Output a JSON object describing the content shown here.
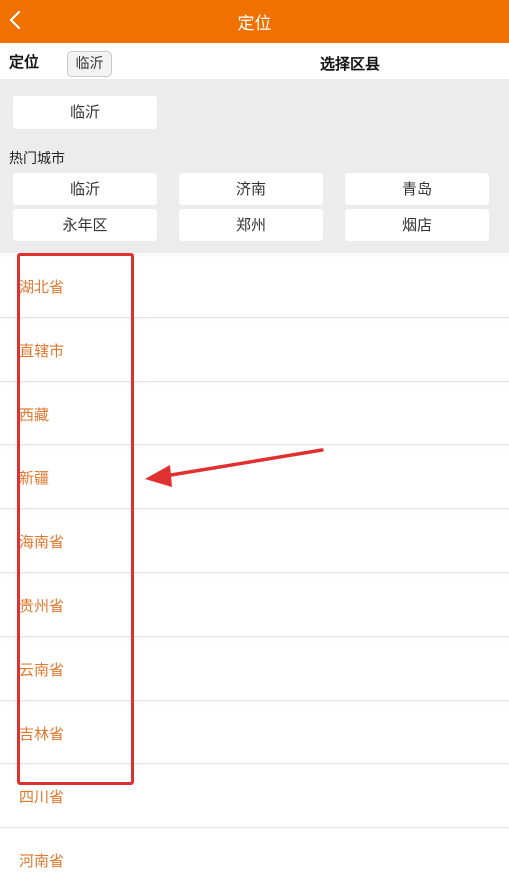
{
  "header": {
    "title": "定位",
    "back_icon": "chevron-left-icon"
  },
  "location_bar": {
    "label": "定位",
    "current_city_chip": "临沂",
    "select_district": "选择区县"
  },
  "current_city_button": "临沂",
  "hot_cities": {
    "title": "热门城市",
    "items": [
      "临沂",
      "济南",
      "青岛",
      "永年区",
      "郑州",
      "烟店"
    ]
  },
  "provinces": [
    "湖北省",
    "直辖市",
    "西藏",
    "新疆",
    "海南省",
    "贵州省",
    "云南省",
    "吉林省",
    "四川省",
    "河南省"
  ],
  "colors": {
    "header_bg": "#f07000",
    "province_text": "#e0782e",
    "annotation_red": "#e03030"
  }
}
